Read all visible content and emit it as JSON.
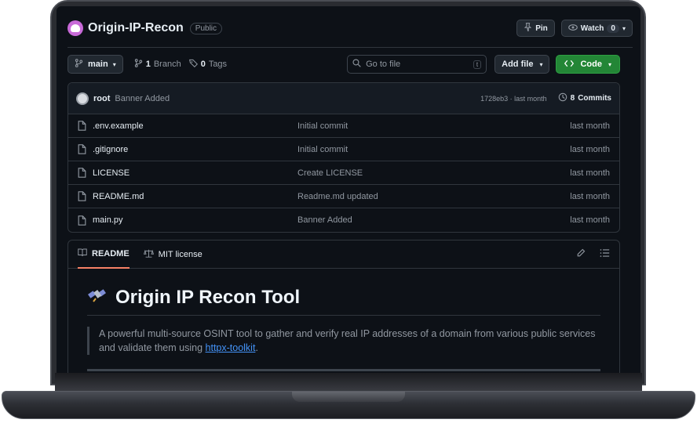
{
  "repo": {
    "name": "Origin-IP-Recon",
    "visibility": "Public",
    "pin_label": "Pin",
    "watch_label": "Watch",
    "watch_count": "0"
  },
  "branch_bar": {
    "branch": "main",
    "branch_count": "1",
    "branch_label": "Branch",
    "tag_count": "0",
    "tag_label": "Tags",
    "search_placeholder": "Go to file",
    "search_key": "t",
    "add_file_label": "Add file",
    "code_label": "Code"
  },
  "latest_commit": {
    "author": "root",
    "message": "Banner Added",
    "hash_time": "1728eb3 · last month",
    "commits_count": "8",
    "commits_label": "Commits"
  },
  "files": [
    {
      "name": ".env.example",
      "message": "Initial commit",
      "time": "last month"
    },
    {
      "name": ".gitignore",
      "message": "Initial commit",
      "time": "last month"
    },
    {
      "name": "LICENSE",
      "message": "Create LICENSE",
      "time": "last month"
    },
    {
      "name": "README.md",
      "message": "Readme.md updated",
      "time": "last month"
    },
    {
      "name": "main.py",
      "message": "Banner Added",
      "time": "last month"
    }
  ],
  "readme": {
    "tab_readme": "README",
    "tab_license": "MIT license",
    "title": "Origin IP Recon Tool",
    "description_before": "A powerful multi-source OSINT tool to gather and verify real IP addresses of a domain from various public services and validate them using ",
    "description_link": "httpx-toolkit",
    "description_after": "."
  },
  "colors": {
    "background": "#0d1117",
    "code_button": "#238636",
    "active_tab_underline": "#f78166",
    "link": "#4493f8"
  },
  "icons": [
    "avatar-icon",
    "pin-icon",
    "eye-icon",
    "branch-icon",
    "tag-icon",
    "search-icon",
    "code-icon",
    "history-icon",
    "file-icon",
    "book-icon",
    "scale-icon",
    "pencil-icon",
    "list-icon",
    "satellite-icon"
  ]
}
